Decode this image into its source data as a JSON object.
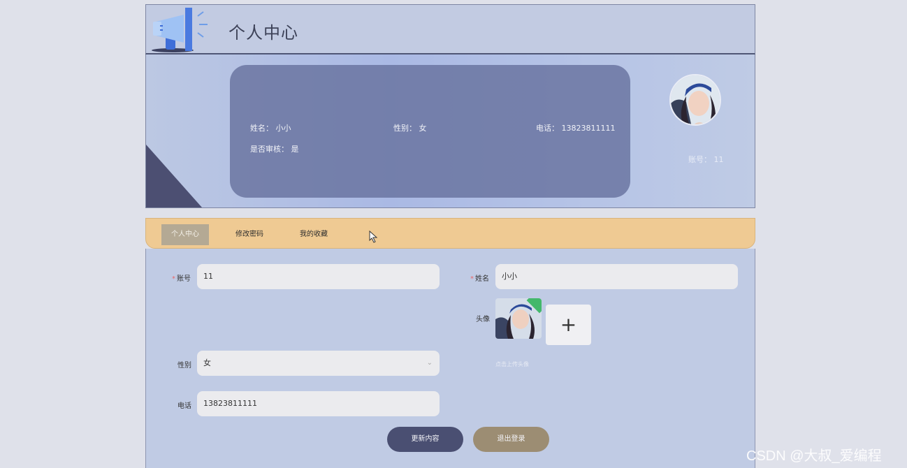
{
  "header": {
    "title": "个人中心"
  },
  "profile": {
    "name_label": "姓名：",
    "name_value": "小小",
    "gender_label": "性别：",
    "gender_value": "女",
    "phone_label": "电话：",
    "phone_value": "13823811111",
    "review_label": "是否审核：",
    "review_value": "是",
    "account_label": "账号：",
    "account_value": "11"
  },
  "tabs": [
    {
      "label": "个人中心",
      "active": true
    },
    {
      "label": "修改密码",
      "active": false
    },
    {
      "label": "我的收藏",
      "active": false
    }
  ],
  "form": {
    "account_label": "账号",
    "account_value": "11",
    "name_label": "姓名",
    "name_value": "小小",
    "avatar_label": "头像",
    "upload_symbol": "+",
    "upload_hint": "点击上传头像",
    "gender_label": "性别",
    "gender_value": "女",
    "phone_label": "电话",
    "phone_value": "13823811111",
    "required_mark": "*"
  },
  "buttons": {
    "update": "更新内容",
    "logout": "退出登录"
  },
  "watermark": "CSDN @大叔_爱编程",
  "colors": {
    "tab_bar": "#efca93",
    "update_button": "#4a4f72",
    "logout_button": "#9c8d73"
  }
}
